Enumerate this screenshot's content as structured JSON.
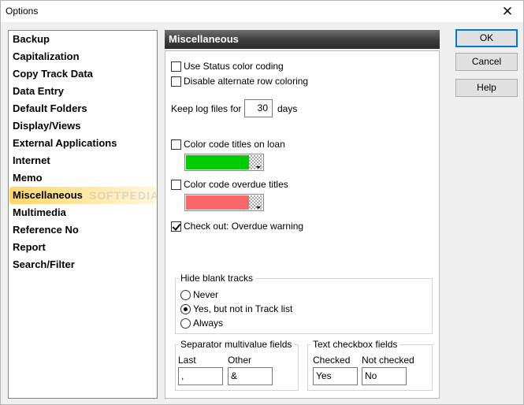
{
  "window": {
    "title": "Options"
  },
  "categories": [
    "Backup",
    "Capitalization",
    "Copy Track Data",
    "Data Entry",
    "Default Folders",
    "Display/Views",
    "External Applications",
    "Internet",
    "Memo",
    "Miscellaneous",
    "Multimedia",
    "Reference No",
    "Report",
    "Search/Filter"
  ],
  "selected_category": "Miscellaneous",
  "watermark": "SOFTPEDIA",
  "panel": {
    "title": "Miscellaneous",
    "use_status_color": {
      "label": "Use Status color coding",
      "checked": false
    },
    "disable_alt_row": {
      "label": "Disable alternate row coloring",
      "checked": false
    },
    "keep_log": {
      "label": "Keep log files for",
      "value": "30",
      "unit": "days"
    },
    "color_titles_on_loan": {
      "label": "Color code titles on loan",
      "checked": false,
      "color": "#00cc00"
    },
    "color_overdue": {
      "label": "Color code overdue titles",
      "checked": false,
      "color": "#f86868"
    },
    "checkout_warning": {
      "label": "Check out: Overdue warning",
      "checked": true
    },
    "hide_blank_tracks": {
      "title": "Hide blank tracks",
      "options": [
        "Never",
        "Yes, but not in Track list",
        "Always"
      ],
      "selected": 1
    },
    "separator": {
      "title": "Separator multivalue fields",
      "last_label": "Last",
      "last_value": ",",
      "other_label": "Other",
      "other_value": "&"
    },
    "text_checkbox": {
      "title": "Text checkbox fields",
      "checked_label": "Checked",
      "checked_value": "Yes",
      "not_checked_label": "Not checked",
      "not_checked_value": "No"
    }
  },
  "buttons": {
    "ok": "OK",
    "cancel": "Cancel",
    "help": "Help"
  },
  "icons": {
    "close": "close-icon"
  }
}
